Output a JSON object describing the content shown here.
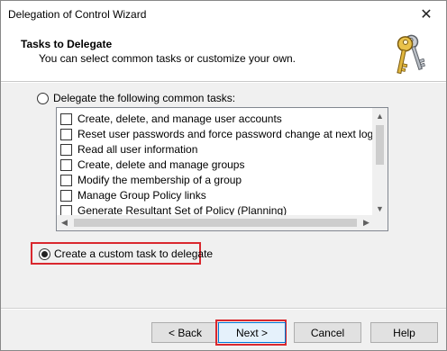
{
  "window": {
    "title": "Delegation of Control Wizard",
    "close_glyph": "✕"
  },
  "header": {
    "title": "Tasks to Delegate",
    "subtitle": "You can select common tasks or customize your own.",
    "icon": "keys-icon"
  },
  "options": {
    "common_tasks": {
      "label": "Delegate the following common tasks:",
      "selected": false
    },
    "custom_task": {
      "label": "Create a custom task to delegate",
      "selected": true
    }
  },
  "tasks": [
    {
      "label": "Create, delete, and manage user accounts",
      "checked": false
    },
    {
      "label": "Reset user passwords and force password change at next logon",
      "checked": false
    },
    {
      "label": "Read all user information",
      "checked": false
    },
    {
      "label": "Create, delete and manage groups",
      "checked": false
    },
    {
      "label": "Modify the membership of a group",
      "checked": false
    },
    {
      "label": "Manage Group Policy links",
      "checked": false
    },
    {
      "label": "Generate Resultant Set of Policy (Planning)",
      "checked": false
    }
  ],
  "buttons": {
    "back": "< Back",
    "next": "Next >",
    "cancel": "Cancel",
    "help": "Help"
  },
  "colors": {
    "highlight": "#d9272e",
    "focus": "#0078d7"
  }
}
